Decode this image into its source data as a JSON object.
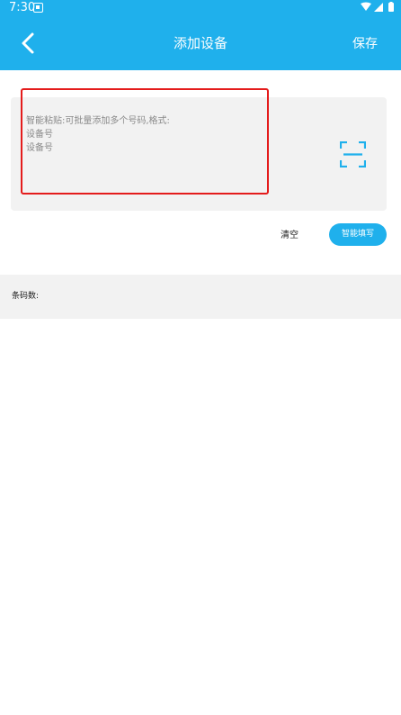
{
  "status_bar": {
    "time": "7:30",
    "icons": [
      "notification-icon",
      "wifi-icon",
      "signal-icon",
      "battery-icon"
    ]
  },
  "header": {
    "back_icon": "chevron-left-icon",
    "title": "添加设备",
    "save_label": "保存",
    "background_color": "#1fb0ec"
  },
  "input": {
    "placeholder": "智能粘贴:可批量添加多个号码,格式:\n设备号\n设备号",
    "scan_icon": "scan-icon",
    "highlight_color": "#e41c1c"
  },
  "actions": {
    "clear_label": "清空",
    "smart_fill_label": "智能填写"
  },
  "count": {
    "label": "条码数:"
  }
}
